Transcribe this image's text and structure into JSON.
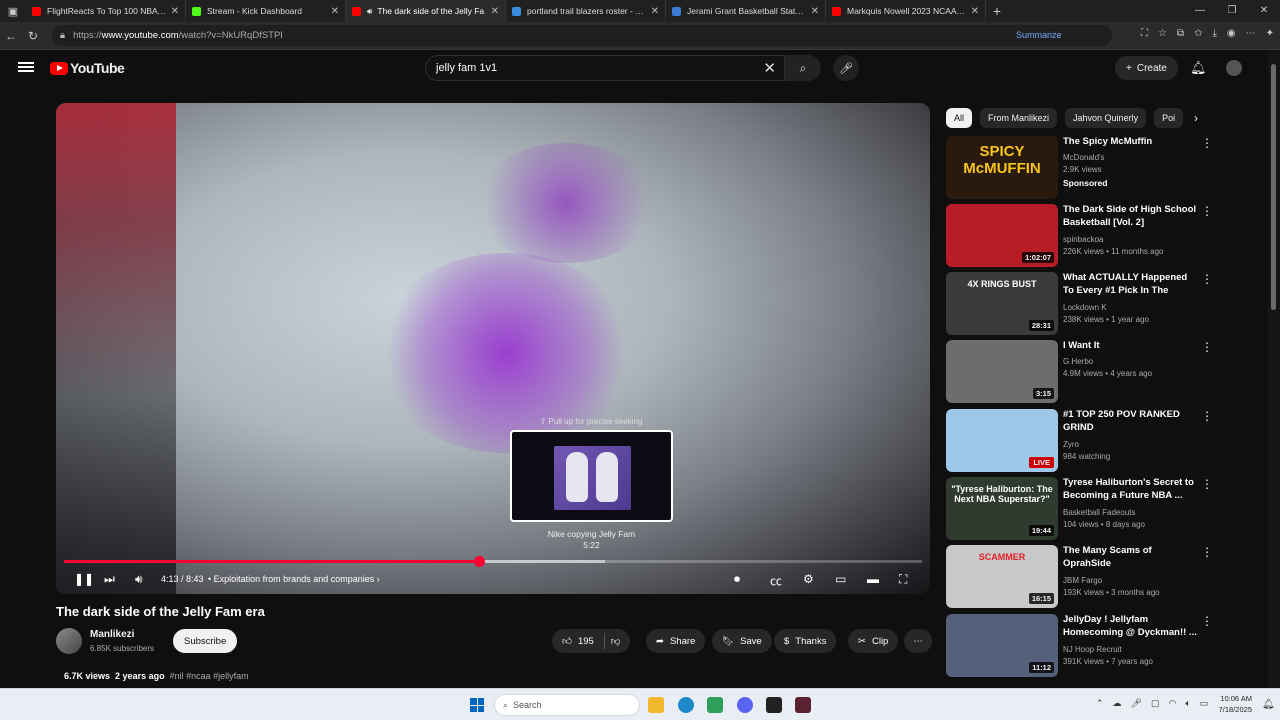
{
  "browser": {
    "tabs": [
      {
        "title": "FlightReacts To Top 100 NBA Play",
        "color": "#ff0000",
        "active": false
      },
      {
        "title": "Stream - Kick Dashboard",
        "color": "#53fc18",
        "active": false
      },
      {
        "title": "The dark side of the Jelly Fa",
        "color": "#ff0000",
        "active": true
      },
      {
        "title": "portland trail blazers roster - Sea",
        "color": "#3a8dde",
        "active": false
      },
      {
        "title": "Jerami Grant Basketball Stats - Sp",
        "color": "#3a7bd5",
        "active": false
      },
      {
        "title": "Markquis Nowell 2023 NCAA tou",
        "color": "#ff0000",
        "active": false
      }
    ],
    "url_prefix": "https://",
    "url_domain": "www.youtube.com",
    "url_path": "/watch?v=NkURqDfSTPI",
    "summarize_label": "Summarize"
  },
  "youtube": {
    "logo_text": "YouTube",
    "search_value": "jelly fam 1v1",
    "create_label": "Create"
  },
  "player": {
    "seek_hint": "Pull up for precise seeking",
    "preview_title": "Nike copying Jelly Fam",
    "preview_time": "5:22",
    "time_text": "4:13 / 8:43",
    "chapter": "• Exploitation from brands and companies",
    "played_fraction": 0.484,
    "buffered_fraction": 0.63
  },
  "video": {
    "title": "The dark side of the Jelly Fam era",
    "channel": "Manlikezi",
    "subscribers": "6.85K subscribers",
    "subscribe_label": "Subscribe",
    "likes": "195",
    "share_label": "Share",
    "save_label": "Save",
    "thanks_label": "Thanks",
    "clip_label": "Clip",
    "views": "6.7K views",
    "age": "2 years ago",
    "tags": "#nil #ncaa #jellyfam"
  },
  "chips": [
    "All",
    "From Manlikezi",
    "Jahvon Quinerly",
    "Poi"
  ],
  "recommendations": [
    {
      "title": "The Spicy McMuffin",
      "channel": "McDonald's",
      "views": "2.9K views",
      "badge": "Sponsored",
      "thumb_text": "SPICY McMUFFIN",
      "thumb_bg": "#2a1a0d"
    },
    {
      "title": "The Dark Side of High School Basketball [Vol. 2]",
      "channel": "spinbackoa",
      "views": "226K views • 11 months ago",
      "duration": "1:02:07",
      "thumb_bg": "#b81c24"
    },
    {
      "title": "What ACTUALLY Happened To Every #1 Pick In The 2000's?",
      "channel": "Lockdown K",
      "views": "238K views • 1 year ago",
      "duration": "28:31",
      "thumb_text": "4X RINGS  BUST",
      "thumb_bg": "#3b3b3b"
    },
    {
      "title": "I Want It",
      "channel": "G Herbo",
      "views": "4.9M views • 4 years ago",
      "duration": "3:15",
      "thumb_bg": "#6d6d6d"
    },
    {
      "title": "#1 TOP 250 POV RANKED GRIND",
      "channel": "Zyro",
      "views": "984 watching",
      "live": "LIVE",
      "thumb_bg": "#9fc7e8"
    },
    {
      "title": "Tyrese Haliburton's Secret to Becoming a Future NBA ...",
      "channel": "Basketball Fadeouts",
      "views": "104 views • 8 days ago",
      "duration": "19:44",
      "thumb_text": "\"Tyrese Haliburton: The Next NBA Superstar?\"",
      "thumb_bg": "#2f3b2f"
    },
    {
      "title": "The Many Scams of OprahSide",
      "channel": "JBM Fargo",
      "views": "193K views • 3 months ago",
      "duration": "16:15",
      "thumb_text": "SCAMMER",
      "thumb_bg": "#c8c8c8"
    },
    {
      "title": "JellyDay ! Jellyfam Homecoming @ Dyckman!! ...",
      "channel": "NJ Hoop Recruit",
      "views": "391K views • 7 years ago",
      "duration": "11:12",
      "thumb_bg": "#55607a"
    }
  ],
  "taskbar": {
    "search_placeholder": "Search",
    "time": "10:06 AM",
    "date": "7/18/2025"
  }
}
